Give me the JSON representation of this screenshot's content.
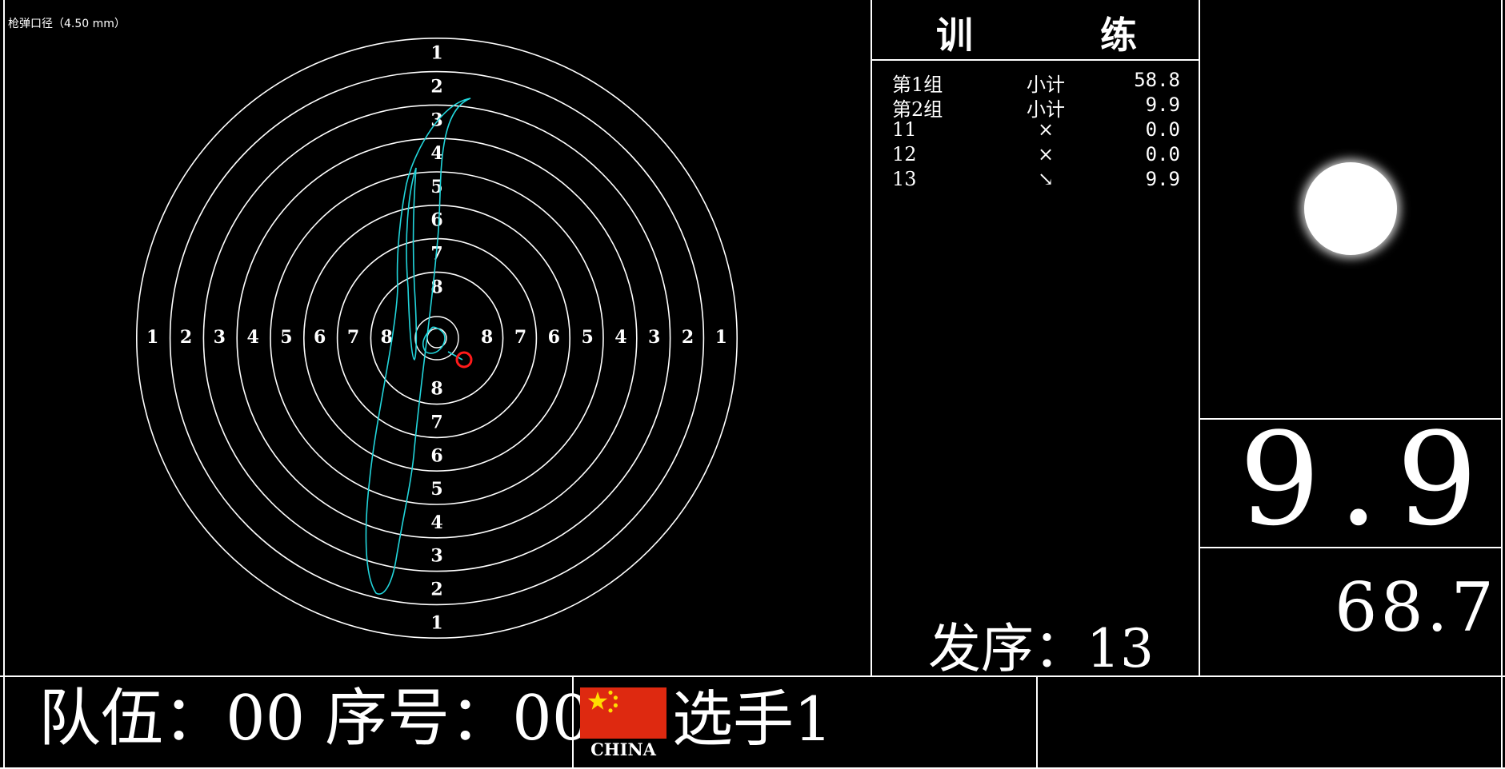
{
  "caliber_label": "枪弹口径（4.50 mm）",
  "target": {
    "ring_labels_top": [
      "1",
      "2",
      "3",
      "4",
      "5",
      "6",
      "7",
      "8"
    ],
    "ring_labels_bottom": [
      "8",
      "7",
      "6",
      "5",
      "4",
      "3",
      "2",
      "1"
    ],
    "ring_labels_left": [
      "1",
      "2",
      "3",
      "4",
      "5",
      "6",
      "7",
      "8"
    ],
    "ring_labels_right": [
      "8",
      "7",
      "6",
      "5",
      "4",
      "3",
      "2",
      "1"
    ],
    "ring_color": "#ffffff",
    "trace_color": "#22d6dc",
    "hit_color": "#ff1a1a"
  },
  "mode_title": {
    "char1": "训",
    "char2": "练"
  },
  "score_list": [
    {
      "label": "第1组",
      "mark": "小计",
      "value": "58.8"
    },
    {
      "label": "第2组",
      "mark": "小计",
      "value": "9.9"
    },
    {
      "label": "11",
      "mark": "×",
      "value": "0.0"
    },
    {
      "label": "12",
      "mark": "×",
      "value": "0.0"
    },
    {
      "label": "13",
      "mark": "↘",
      "value": "9.9"
    }
  ],
  "shot_sequence": {
    "label": "发序：",
    "value": "13"
  },
  "last_shot_score": "9.9",
  "total_score": "68.7",
  "team": {
    "team_label": "队伍：",
    "team_value": "00",
    "number_label": "序号：",
    "number_value": "00"
  },
  "player": {
    "flag_country": "CHINA",
    "name": "选手1"
  },
  "flag_colors": {
    "red": "#de2910",
    "star": "#ffde00"
  }
}
